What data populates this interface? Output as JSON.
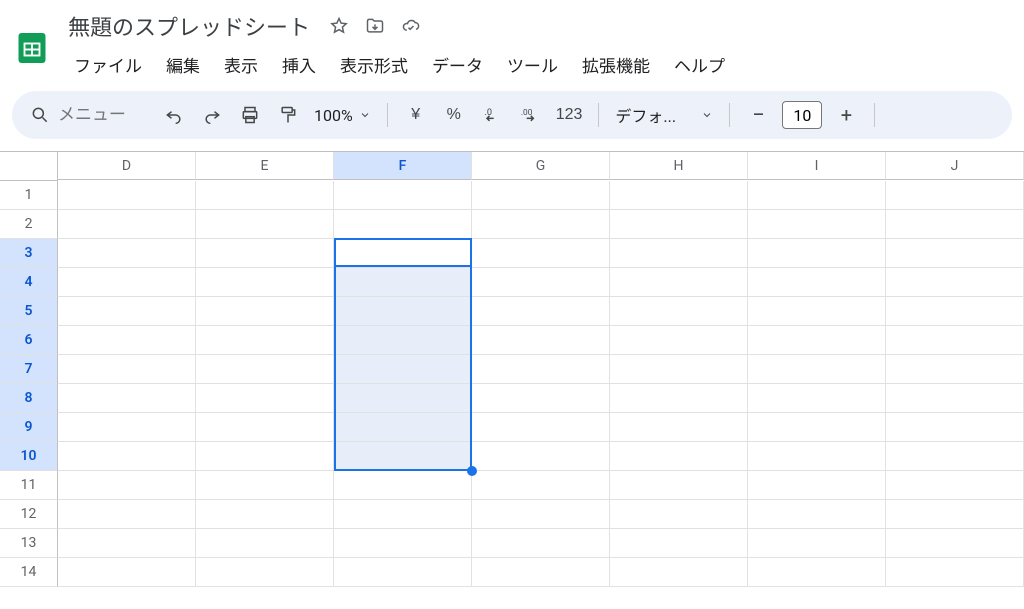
{
  "doc": {
    "title": "無題のスプレッドシート"
  },
  "menubar": {
    "items": [
      "ファイル",
      "編集",
      "表示",
      "挿入",
      "表示形式",
      "データ",
      "ツール",
      "拡張機能",
      "ヘルプ"
    ]
  },
  "toolbar": {
    "search_placeholder": "メニュー",
    "zoom": "100%",
    "currency": "¥",
    "percent": "%",
    "dec_decrease": ".0",
    "dec_increase": ".00",
    "number_format": "123",
    "font": "デフォ...",
    "font_size": "10",
    "minus": "−",
    "plus": "+"
  },
  "grid": {
    "columns": [
      "D",
      "E",
      "F",
      "G",
      "H",
      "I",
      "J"
    ],
    "rows": [
      1,
      2,
      3,
      4,
      5,
      6,
      7,
      8,
      9,
      10,
      11,
      12,
      13,
      14
    ],
    "selected_column": "F",
    "selected_rows_start": 3,
    "selected_rows_end": 10,
    "active_cell": "F3"
  }
}
